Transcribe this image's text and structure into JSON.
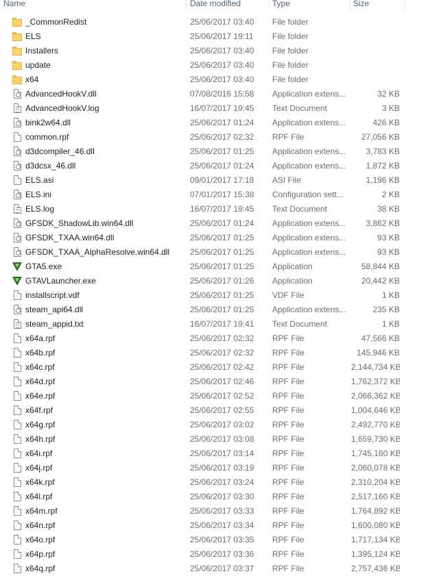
{
  "columns": {
    "name": "Name",
    "date": "Date modified",
    "type": "Type",
    "size": "Size"
  },
  "files": [
    {
      "name": "_CommonRedist",
      "date": "25/06/2017 03:40",
      "type": "File folder",
      "size": "",
      "icon": "folder-icon"
    },
    {
      "name": "ELS",
      "date": "25/06/2017 19:11",
      "type": "File folder",
      "size": "",
      "icon": "folder-icon"
    },
    {
      "name": "Installers",
      "date": "25/06/2017 03:40",
      "type": "File folder",
      "size": "",
      "icon": "folder-icon"
    },
    {
      "name": "update",
      "date": "25/06/2017 03:40",
      "type": "File folder",
      "size": "",
      "icon": "folder-icon"
    },
    {
      "name": "x64",
      "date": "25/06/2017 03:40",
      "type": "File folder",
      "size": "",
      "icon": "folder-icon"
    },
    {
      "name": "AdvancedHookV.dll",
      "date": "07/08/2016 15:58",
      "type": "Application extens...",
      "size": "32 KB",
      "icon": "dll-icon"
    },
    {
      "name": "AdvancedHookV.log",
      "date": "16/07/2017 19:45",
      "type": "Text Document",
      "size": "3 KB",
      "icon": "text-file-icon"
    },
    {
      "name": "bink2w64.dll",
      "date": "25/06/2017 01:24",
      "type": "Application extens...",
      "size": "426 KB",
      "icon": "dll-icon"
    },
    {
      "name": "common.rpf",
      "date": "25/06/2017 02:32",
      "type": "RPF File",
      "size": "27,056 KB",
      "icon": "file-icon"
    },
    {
      "name": "d3dcompiler_46.dll",
      "date": "25/06/2017 01:25",
      "type": "Application extens...",
      "size": "3,783 KB",
      "icon": "dll-icon"
    },
    {
      "name": "d3dcsx_46.dll",
      "date": "25/06/2017 01:24",
      "type": "Application extens...",
      "size": "1,872 KB",
      "icon": "dll-icon"
    },
    {
      "name": "ELS.asi",
      "date": "09/01/2017 17:18",
      "type": "ASI File",
      "size": "1,196 KB",
      "icon": "file-icon"
    },
    {
      "name": "ELS.ini",
      "date": "07/01/2017 15:38",
      "type": "Configuration sett...",
      "size": "2 KB",
      "icon": "config-file-icon"
    },
    {
      "name": "ELS.log",
      "date": "16/07/2017 19:45",
      "type": "Text Document",
      "size": "38 KB",
      "icon": "text-file-icon"
    },
    {
      "name": "GFSDK_ShadowLib.win64.dll",
      "date": "25/06/2017 01:24",
      "type": "Application extens...",
      "size": "3,862 KB",
      "icon": "dll-icon"
    },
    {
      "name": "GFSDK_TXAA.win64.dll",
      "date": "25/06/2017 01:25",
      "type": "Application extens...",
      "size": "93 KB",
      "icon": "dll-icon"
    },
    {
      "name": "GFSDK_TXAA_AlphaResolve.win64.dll",
      "date": "25/06/2017 01:25",
      "type": "Application extens...",
      "size": "93 KB",
      "icon": "dll-icon"
    },
    {
      "name": "GTA5.exe",
      "date": "25/06/2017 01:25",
      "type": "Application",
      "size": "58,844 KB",
      "icon": "gta-app-icon"
    },
    {
      "name": "GTAVLauncher.exe",
      "date": "25/06/2017 01:26",
      "type": "Application",
      "size": "20,442 KB",
      "icon": "gta-app-icon"
    },
    {
      "name": "installscript.vdf",
      "date": "25/06/2017 01:25",
      "type": "VDF File",
      "size": "1 KB",
      "icon": "file-icon"
    },
    {
      "name": "steam_api64.dll",
      "date": "25/06/2017 01:25",
      "type": "Application extens...",
      "size": "235 KB",
      "icon": "dll-icon"
    },
    {
      "name": "steam_appid.txt",
      "date": "16/07/2017 19:41",
      "type": "Text Document",
      "size": "1 KB",
      "icon": "text-file-icon"
    },
    {
      "name": "x64a.rpf",
      "date": "25/06/2017 02:32",
      "type": "RPF File",
      "size": "47,566 KB",
      "icon": "file-icon"
    },
    {
      "name": "x64b.rpf",
      "date": "25/06/2017 02:32",
      "type": "RPF File",
      "size": "145,946 KB",
      "icon": "file-icon"
    },
    {
      "name": "x64c.rpf",
      "date": "25/06/2017 02:42",
      "type": "RPF File",
      "size": "2,144,734 KB",
      "icon": "file-icon"
    },
    {
      "name": "x64d.rpf",
      "date": "25/06/2017 02:46",
      "type": "RPF File",
      "size": "1,762,372 KB",
      "icon": "file-icon"
    },
    {
      "name": "x64e.rpf",
      "date": "25/06/2017 02:52",
      "type": "RPF File",
      "size": "2,066,362 KB",
      "icon": "file-icon"
    },
    {
      "name": "x64f.rpf",
      "date": "25/06/2017 02:55",
      "type": "RPF File",
      "size": "1,004,646 KB",
      "icon": "file-icon"
    },
    {
      "name": "x64g.rpf",
      "date": "25/06/2017 03:02",
      "type": "RPF File",
      "size": "2,492,770 KB",
      "icon": "file-icon"
    },
    {
      "name": "x64h.rpf",
      "date": "25/06/2017 03:08",
      "type": "RPF File",
      "size": "1,659,730 KB",
      "icon": "file-icon"
    },
    {
      "name": "x64i.rpf",
      "date": "25/06/2017 03:14",
      "type": "RPF File",
      "size": "1,745,160 KB",
      "icon": "file-icon"
    },
    {
      "name": "x64j.rpf",
      "date": "25/06/2017 03:19",
      "type": "RPF File",
      "size": "2,060,078 KB",
      "icon": "file-icon"
    },
    {
      "name": "x64k.rpf",
      "date": "25/06/2017 03:24",
      "type": "RPF File",
      "size": "2,310,204 KB",
      "icon": "file-icon"
    },
    {
      "name": "x64l.rpf",
      "date": "25/06/2017 03:30",
      "type": "RPF File",
      "size": "2,517,160 KB",
      "icon": "file-icon"
    },
    {
      "name": "x64m.rpf",
      "date": "25/06/2017 03:33",
      "type": "RPF File",
      "size": "1,764,892 KB",
      "icon": "file-icon"
    },
    {
      "name": "x64n.rpf",
      "date": "25/06/2017 03:34",
      "type": "RPF File",
      "size": "1,600,080 KB",
      "icon": "file-icon"
    },
    {
      "name": "x64o.rpf",
      "date": "25/06/2017 03:35",
      "type": "RPF File",
      "size": "1,717,134 KB",
      "icon": "file-icon"
    },
    {
      "name": "x64p.rpf",
      "date": "25/06/2017 03:36",
      "type": "RPF File",
      "size": "1,395,124 KB",
      "icon": "file-icon"
    },
    {
      "name": "x64q.rpf",
      "date": "25/06/2017 03:37",
      "type": "RPF File",
      "size": "2,757,436 KB",
      "icon": "file-icon"
    }
  ]
}
